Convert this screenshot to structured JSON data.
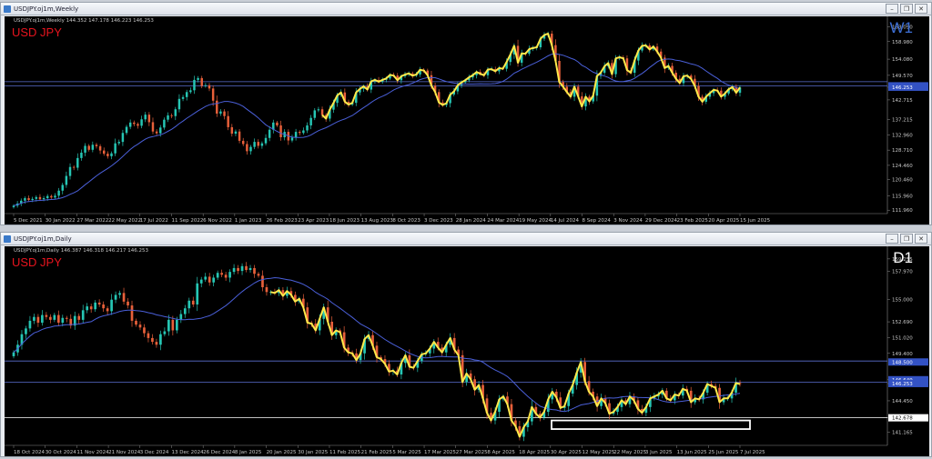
{
  "weekly": {
    "title": "USDJPY.oj1m,Weekly",
    "info": "USDJPY.oj1m,Weekly  144.352 147.178 146.223 146.253",
    "symbol": "USD JPY",
    "timeframe": "W1",
    "tf_color": "#3d6fd6"
  },
  "daily": {
    "title": "USDJPY.oj1m,Daily",
    "info": "USDJPY.oj1m,Daily  146.387 146.318 146.217 146.253",
    "symbol": "USD JPY",
    "timeframe": "D1",
    "tf_color": "#ffffff"
  },
  "window_controls": {
    "minimize": "–",
    "restore": "❐",
    "close": "✕"
  },
  "chart_data": [
    {
      "type": "candlestick",
      "name": "USDJPY Weekly",
      "x_labels": [
        "5 Dec 2021",
        "30 Jan 2022",
        "27 Mar 2022",
        "22 May 2022",
        "17 Jul 2022",
        "11 Sep 2022",
        "6 Nov 2022",
        "1 Jan 2023",
        "26 Feb 2023",
        "23 Apr 2023",
        "18 Jun 2023",
        "13 Aug 2023",
        "8 Oct 2023",
        "3 Dec 2023",
        "28 Jan 2024",
        "24 Mar 2024",
        "19 May 2024",
        "14 Jul 2024",
        "8 Sep 2024",
        "3 Nov 2024",
        "29 Dec 2024",
        "23 Feb 2025",
        "20 Apr 2025",
        "15 Jun 2025"
      ],
      "y_ticks": [
        163.09,
        158.98,
        154.08,
        149.57,
        146.253,
        142.715,
        137.215,
        132.96,
        128.71,
        124.46,
        120.46,
        115.96,
        111.96
      ],
      "ylim": [
        111.0,
        164.5
      ],
      "hlines": [
        147.8,
        146.6
      ],
      "price_labels": [
        146.649,
        146.253
      ],
      "close": [
        113.2,
        113.8,
        114.6,
        115.3,
        114.8,
        115.1,
        115.6,
        115.0,
        115.3,
        115.9,
        115.5,
        116.0,
        117.4,
        119.0,
        121.5,
        124.0,
        123.8,
        126.5,
        128.0,
        129.9,
        128.8,
        130.2,
        129.8,
        128.6,
        127.7,
        127.0,
        127.8,
        130.6,
        131.0,
        133.5,
        135.2,
        136.4,
        136.0,
        135.5,
        137.3,
        138.6,
        136.5,
        133.9,
        133.4,
        135.0,
        137.2,
        138.4,
        138.2,
        140.1,
        143.0,
        143.5,
        144.9,
        145.4,
        148.3,
        148.8,
        146.6,
        146.8,
        145.9,
        142.5,
        138.9,
        139.5,
        138.2,
        135.1,
        133.3,
        133.9,
        131.3,
        130.4,
        128.4,
        129.6,
        131.0,
        129.9,
        130.6,
        132.1,
        134.4,
        136.4,
        135.6,
        132.3,
        133.8,
        131.4,
        132.2,
        133.8,
        133.5,
        134.2,
        135.6,
        137.7,
        139.8,
        140.1,
        138.5,
        137.5,
        140.0,
        141.9,
        144.0,
        144.8,
        142.2,
        141.4,
        141.9,
        144.8,
        145.8,
        146.5,
        145.6,
        147.9,
        148.3,
        147.8,
        148.3,
        148.7,
        149.7,
        149.5,
        148.2,
        149.3,
        149.8,
        150.1,
        149.5,
        149.8,
        151.1,
        150.9,
        149.6,
        146.7,
        144.9,
        142.0,
        141.3,
        141.8,
        144.2,
        145.1,
        146.8,
        147.6,
        148.2,
        149.0,
        149.6,
        150.5,
        150.0,
        149.6,
        151.2,
        151.3,
        150.7,
        151.6,
        151.4,
        153.3,
        155.4,
        157.8,
        153.1,
        155.7,
        155.6,
        156.9,
        157.2,
        157.4,
        159.8,
        160.8,
        161.2,
        158.0,
        153.6,
        147.7,
        146.4,
        144.9,
        143.6,
        146.4,
        143.7,
        140.9,
        143.6,
        142.3,
        143.9,
        149.4,
        150.3,
        152.1,
        153.0,
        149.9,
        154.3,
        154.6,
        154.3,
        151.0,
        150.3,
        153.7,
        156.5,
        157.8,
        157.9,
        156.8,
        157.6,
        156.2,
        154.5,
        151.6,
        152.2,
        150.3,
        148.6,
        147.4,
        149.3,
        149.5,
        148.6,
        146.6,
        143.6,
        142.2,
        143.6,
        144.6,
        145.5,
        145.3,
        143.6,
        144.5,
        145.7,
        146.3,
        144.7,
        146.2
      ]
    },
    {
      "type": "candlestick",
      "name": "USDJPY Daily",
      "x_labels": [
        "18 Oct 2024",
        "30 Oct 2024",
        "11 Nov 2024",
        "21 Nov 2024",
        "3 Dec 2024",
        "13 Dec 2024",
        "26 Dec 2024",
        "8 Jan 2025",
        "20 Jan 2025",
        "30 Jan 2025",
        "11 Feb 2025",
        "21 Feb 2025",
        "5 Mar 2025",
        "17 Mar 2025",
        "27 Mar 2025",
        "8 Apr 2025",
        "18 Apr 2025",
        "30 Apr 2025",
        "12 May 2025",
        "22 May 2025",
        "3 Jun 2025",
        "13 Jun 2025",
        "25 Jun 2025",
        "7 Jul 2025"
      ],
      "y_ticks": [
        159.255,
        157.97,
        155.0,
        152.69,
        151.02,
        149.4,
        146.649,
        146.253,
        144.45,
        142.678,
        141.165
      ],
      "ylim": [
        139.8,
        160.0
      ],
      "hlines": [
        148.6,
        146.4,
        142.678
      ],
      "price_labels": [
        148.5,
        146.649,
        146.253,
        142.678
      ],
      "close": [
        149.5,
        150.3,
        151.4,
        152.0,
        152.8,
        153.2,
        152.6,
        153.4,
        153.2,
        152.9,
        153.4,
        152.6,
        153.1,
        153.0,
        152.3,
        153.3,
        152.9,
        153.9,
        154.3,
        154.0,
        154.7,
        154.5,
        154.1,
        153.8,
        155.0,
        155.5,
        155.7,
        154.8,
        154.4,
        152.8,
        152.4,
        152.1,
        151.5,
        151.0,
        150.6,
        150.3,
        151.4,
        151.7,
        152.9,
        151.8,
        152.9,
        153.5,
        154.1,
        154.9,
        154.5,
        156.7,
        157.1,
        157.4,
        156.8,
        157.3,
        157.8,
        157.6,
        157.3,
        157.9,
        158.3,
        158.0,
        158.5,
        158.1,
        158.3,
        157.7,
        157.5,
        156.3,
        155.8,
        155.8,
        155.7,
        156.0,
        155.4,
        155.9,
        155.5,
        154.8,
        155.1,
        154.2,
        152.6,
        152.5,
        151.8,
        153.0,
        154.2,
        152.7,
        151.3,
        151.8,
        151.6,
        150.0,
        149.5,
        149.4,
        148.7,
        149.4,
        150.9,
        151.3,
        150.2,
        149.0,
        148.8,
        148.3,
        147.5,
        147.6,
        147.2,
        148.4,
        149.2,
        148.0,
        147.9,
        148.6,
        149.3,
        149.4,
        149.9,
        150.6,
        150.0,
        149.5,
        150.3,
        151.0,
        149.8,
        149.2,
        146.4,
        147.3,
        146.7,
        145.6,
        146.1,
        144.7,
        143.2,
        142.4,
        143.3,
        144.6,
        144.9,
        144.1,
        142.4,
        141.8,
        140.7,
        141.7,
        142.3,
        143.8,
        143.1,
        142.7,
        143.3,
        144.6,
        145.4,
        144.8,
        143.7,
        143.9,
        145.2,
        146.1,
        147.4,
        148.5,
        146.5,
        145.4,
        144.9,
        143.9,
        144.7,
        144.2,
        143.1,
        143.3,
        143.8,
        144.5,
        144.1,
        144.9,
        144.5,
        143.6,
        143.2,
        143.8,
        144.7,
        144.9,
        145.1,
        145.5,
        144.7,
        144.5,
        145.1,
        145.0,
        145.7,
        145.5,
        144.3,
        144.7,
        144.6,
        145.3,
        146.2,
        146.0,
        145.8,
        144.3,
        144.7,
        144.7,
        145.3,
        146.3,
        146.2
      ]
    }
  ]
}
